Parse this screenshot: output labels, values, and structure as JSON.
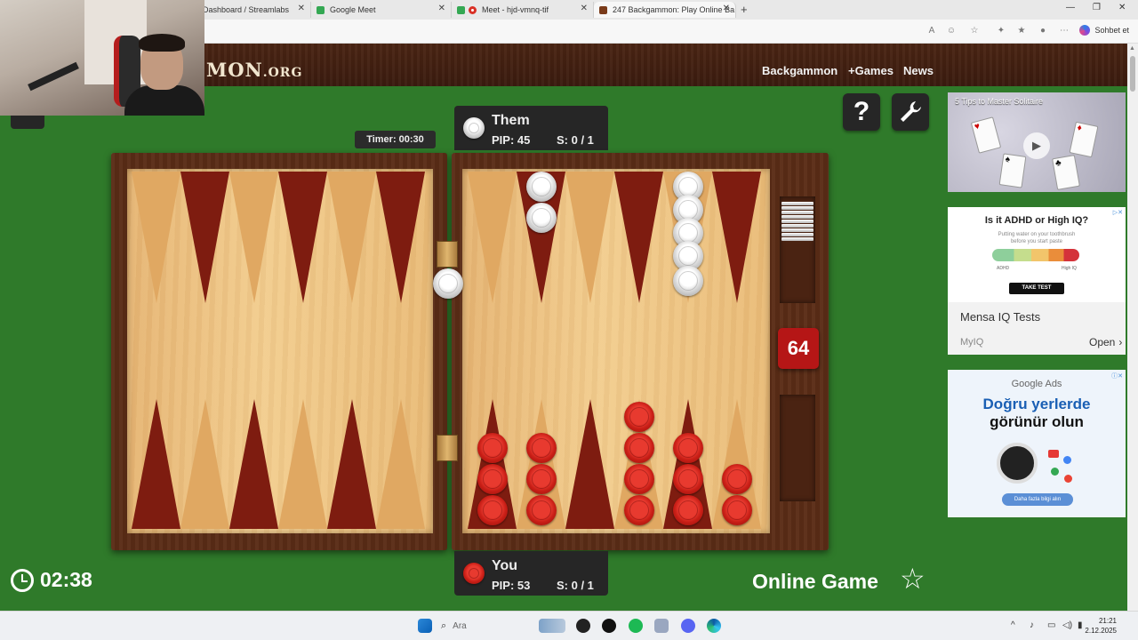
{
  "browser": {
    "tabs": [
      {
        "label": "Dashboard / Streamlabs",
        "icon": "streamlabs-icon",
        "color": "#1f2a35"
      },
      {
        "label": "Google Meet",
        "icon": "meet-icon",
        "color": "#34a853"
      },
      {
        "label": "Meet - hjd-vmnq-tif",
        "icon": "meet-icon",
        "color": "#34a853"
      },
      {
        "label": "247 Backgammon: Play Online Ba",
        "icon": "backgammon-icon",
        "color": "#7a3b1a"
      }
    ],
    "chat_label": "Sohbet et"
  },
  "site": {
    "logo_main": "MON",
    "logo_tld": ".ORG",
    "nav": [
      "Backgammon",
      "+Games",
      "News"
    ],
    "help_icon": "question-icon",
    "settings_icon": "wrench-icon"
  },
  "game": {
    "timer": "Timer: 00:30",
    "opponent": {
      "name": "Them",
      "pip": "PIP: 45",
      "score": "S: 0 / 1",
      "color": "#e6e6e6"
    },
    "player": {
      "name": "You",
      "pip": "PIP: 53",
      "score": "S: 0 / 1",
      "color": "#d32a20"
    },
    "cube_value": "64",
    "clock": "02:38",
    "mode": "Online Game",
    "white_on_bar": 1,
    "white_borne_off": 9,
    "points": {
      "top_right": [
        0,
        2,
        0,
        0,
        0,
        5,
        0
      ],
      "bottom_right_red": [
        3,
        3,
        0,
        4,
        3,
        2
      ]
    }
  },
  "ads": {
    "ad1_title": "5 Tips to Master Solitaire",
    "ad2_title": "Is it ADHD or High IQ?",
    "ad2_sub1": "Putting water on your toothbrush",
    "ad2_sub2": "before you start paste",
    "ad2_low": "ADHD",
    "ad2_high": "High IQ",
    "ad2_btn": "TAKE TEST",
    "ad2_brand": "Mensa IQ Tests",
    "ad2_site": "MyIQ",
    "ad2_open": "Open",
    "ad3_brand": "Google Ads",
    "ad3_h1": "Doğru yerlerde",
    "ad3_h2": "görünür olun",
    "ad3_btn": "Daha fazla bilgi alın"
  },
  "taskbar": {
    "search_placeholder": "Ara",
    "time": "21:21",
    "date": "2.12.2025"
  }
}
